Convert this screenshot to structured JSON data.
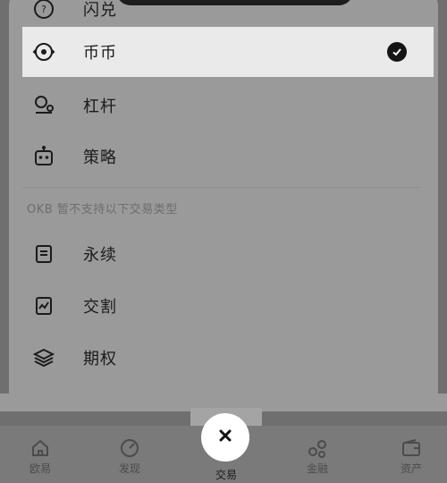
{
  "menu": {
    "top_partial": {
      "label": "闪兑"
    },
    "items": [
      {
        "label": "币币",
        "icon": "spot-icon"
      },
      {
        "label": "杠杆",
        "icon": "margin-icon"
      },
      {
        "label": "策略",
        "icon": "strategy-bot-icon"
      }
    ],
    "note": "OKB 暂不支持以下交易类型",
    "unsupported": [
      {
        "label": "永续",
        "icon": "perpetual-icon"
      },
      {
        "label": "交割",
        "icon": "delivery-icon"
      },
      {
        "label": "期权",
        "icon": "options-icon"
      }
    ]
  },
  "tabs": {
    "home": "欧易",
    "discover": "发现",
    "trade": "交易",
    "finance": "金融",
    "assets": "资产"
  },
  "colors": {
    "selected_bg": "#eaeaea",
    "sheet_bg": "#9a9a9a",
    "overlay_bg": "#6f6f6f"
  }
}
